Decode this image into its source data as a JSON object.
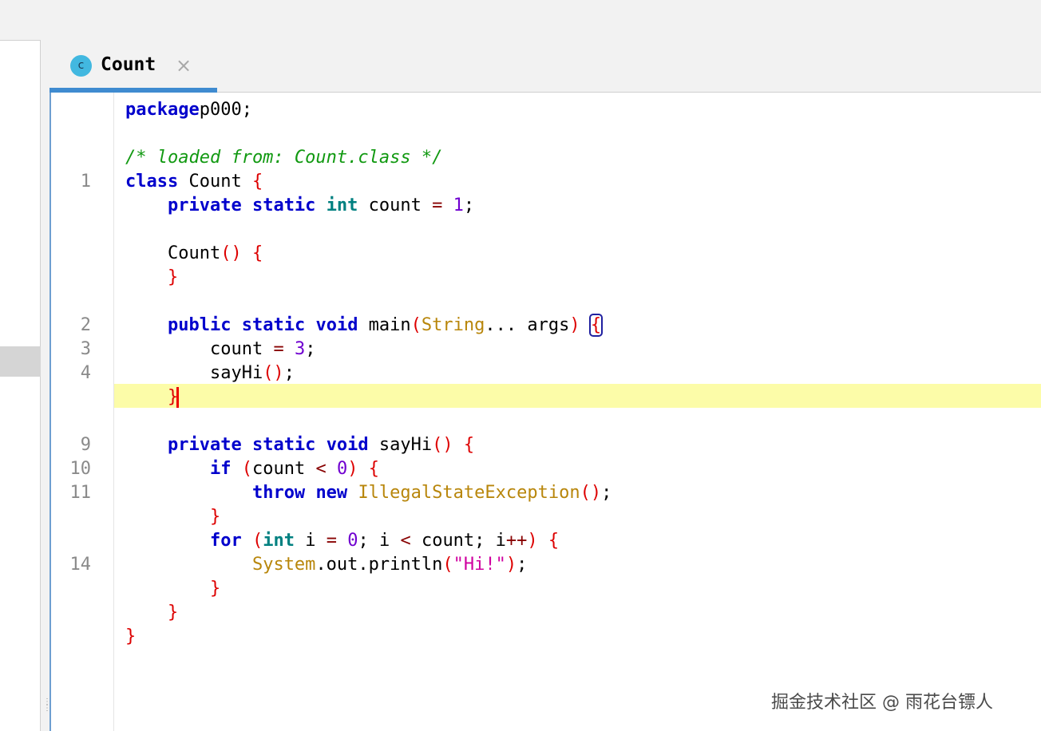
{
  "tab": {
    "icon_letter": "c",
    "title": "Count",
    "close": "×"
  },
  "editor": {
    "lines": [
      {
        "ln": "",
        "tokens": [
          [
            "kw",
            "package"
          ],
          [
            "",
            "p000;"
          ]
        ]
      },
      {
        "ln": "",
        "tokens": []
      },
      {
        "ln": "",
        "tokens": [
          [
            "cm",
            "/* loaded from: Count.class */"
          ]
        ]
      },
      {
        "ln": "1",
        "tokens": [
          [
            "kw",
            "class"
          ],
          [
            "",
            " Count "
          ],
          [
            "br",
            "{"
          ]
        ]
      },
      {
        "ln": "",
        "tokens": [
          [
            "",
            " "
          ],
          [
            "kw",
            "private"
          ],
          [
            "",
            " "
          ],
          [
            "kw",
            "static"
          ],
          [
            "",
            " "
          ],
          [
            "kt",
            "int"
          ],
          [
            "",
            " count "
          ],
          [
            "op",
            "="
          ],
          [
            "",
            " "
          ],
          [
            "nu",
            "1"
          ],
          [
            "",
            ";"
          ]
        ]
      },
      {
        "ln": "",
        "tokens": []
      },
      {
        "ln": "",
        "tokens": [
          [
            "",
            " Count"
          ],
          [
            "br",
            "()"
          ],
          [
            "",
            " "
          ],
          [
            "br",
            "{"
          ]
        ]
      },
      {
        "ln": "",
        "tokens": [
          [
            "",
            " "
          ],
          [
            "br",
            "}"
          ]
        ]
      },
      {
        "ln": "",
        "tokens": []
      },
      {
        "ln": "2",
        "tokens": [
          [
            "",
            " "
          ],
          [
            "kw",
            "public"
          ],
          [
            "",
            " "
          ],
          [
            "kw",
            "static"
          ],
          [
            "",
            " "
          ],
          [
            "kw",
            "void"
          ],
          [
            "",
            " main"
          ],
          [
            "br",
            "("
          ],
          [
            "ty",
            "String"
          ],
          [
            "",
            "... args"
          ],
          [
            "br",
            ")"
          ],
          [
            "",
            " "
          ],
          [
            "br boxed",
            "{"
          ]
        ]
      },
      {
        "ln": "3",
        "tokens": [
          [
            "",
            " count "
          ],
          [
            "op",
            "="
          ],
          [
            "",
            " "
          ],
          [
            "nu",
            "3"
          ],
          [
            "",
            ";"
          ]
        ]
      },
      {
        "ln": "4",
        "tokens": [
          [
            "",
            " sayHi"
          ],
          [
            "br",
            "()"
          ],
          [
            "",
            ";"
          ]
        ]
      },
      {
        "ln": "",
        "tokens": [
          [
            "",
            " "
          ],
          [
            "br",
            "}"
          ],
          [
            "caret",
            ""
          ]
        ]
      },
      {
        "ln": "",
        "tokens": []
      },
      {
        "ln": "9",
        "tokens": [
          [
            "",
            " "
          ],
          [
            "kw",
            "private"
          ],
          [
            "",
            " "
          ],
          [
            "kw",
            "static"
          ],
          [
            "",
            " "
          ],
          [
            "kw",
            "void"
          ],
          [
            "",
            " sayHi"
          ],
          [
            "br",
            "()"
          ],
          [
            "",
            " "
          ],
          [
            "br",
            "{"
          ]
        ]
      },
      {
        "ln": "10",
        "tokens": [
          [
            "",
            " "
          ],
          [
            "kw",
            "if"
          ],
          [
            "",
            " "
          ],
          [
            "br",
            "("
          ],
          [
            "",
            "count "
          ],
          [
            "op",
            "<"
          ],
          [
            "",
            " "
          ],
          [
            "nu",
            "0"
          ],
          [
            "br",
            ")"
          ],
          [
            "",
            " "
          ],
          [
            "br",
            "{"
          ]
        ]
      },
      {
        "ln": "11",
        "tokens": [
          [
            "",
            " "
          ],
          [
            "kw",
            "throw"
          ],
          [
            "",
            " "
          ],
          [
            "kw",
            "new"
          ],
          [
            "",
            " "
          ],
          [
            "ty",
            "IllegalStateException"
          ],
          [
            "br",
            "()"
          ],
          [
            "",
            ";"
          ]
        ]
      },
      {
        "ln": "",
        "tokens": [
          [
            "",
            " "
          ],
          [
            "br",
            "}"
          ]
        ]
      },
      {
        "ln": "",
        "tokens": [
          [
            "",
            " "
          ],
          [
            "kw",
            "for"
          ],
          [
            "",
            " "
          ],
          [
            "br",
            "("
          ],
          [
            "kt",
            "int"
          ],
          [
            "",
            " i "
          ],
          [
            "op",
            "="
          ],
          [
            "",
            " "
          ],
          [
            "nu",
            "0"
          ],
          [
            "",
            "; i "
          ],
          [
            "op",
            "<"
          ],
          [
            "",
            " count; i"
          ],
          [
            "op",
            "++"
          ],
          [
            "br",
            ")"
          ],
          [
            "",
            " "
          ],
          [
            "br",
            "{"
          ]
        ]
      },
      {
        "ln": "14",
        "tokens": [
          [
            "",
            " "
          ],
          [
            "ty",
            "System"
          ],
          [
            "",
            ".out.println"
          ],
          [
            "br",
            "("
          ],
          [
            "st",
            "\"Hi!\""
          ],
          [
            "br",
            ")"
          ],
          [
            "",
            ";"
          ]
        ]
      },
      {
        "ln": "",
        "tokens": [
          [
            "",
            " "
          ],
          [
            "br",
            "}"
          ]
        ]
      },
      {
        "ln": "",
        "tokens": [
          [
            "",
            " "
          ],
          [
            "br",
            "}"
          ]
        ]
      },
      {
        "ln": "",
        "tokens": [
          [
            "br",
            "}"
          ]
        ]
      }
    ]
  },
  "watermark": "掘金技术社区 @ 雨花台镖人"
}
